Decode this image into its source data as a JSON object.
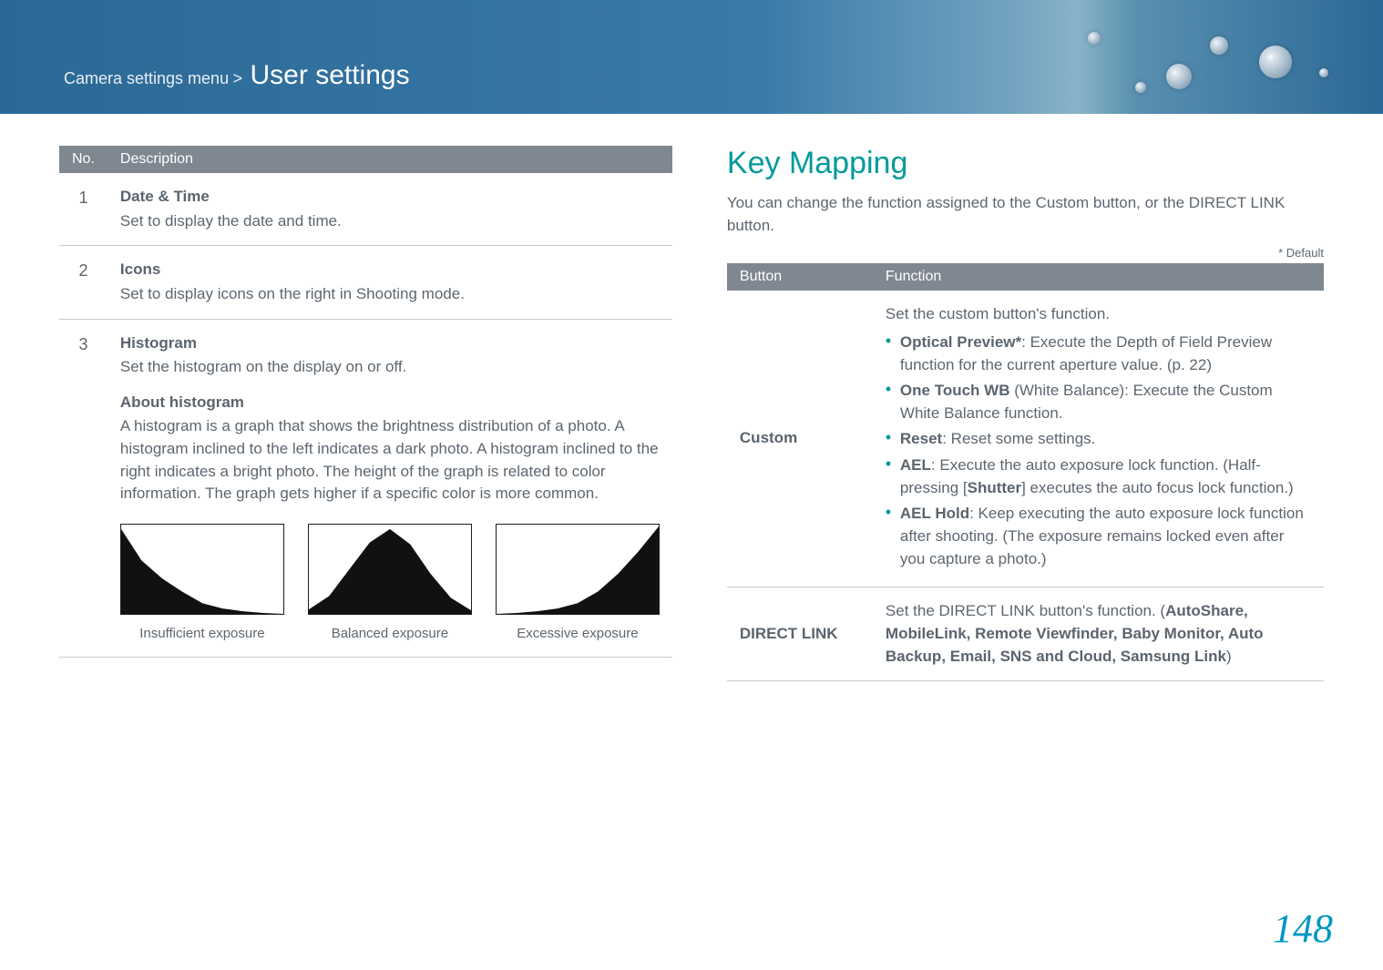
{
  "header": {
    "crumb": "Camera settings menu",
    "title": "User settings"
  },
  "left_table": {
    "headers": {
      "no": "No.",
      "desc": "Description"
    },
    "rows": [
      {
        "no": "1",
        "label": "Date & Time",
        "text": "Set to display the date and time."
      },
      {
        "no": "2",
        "label": "Icons",
        "text": "Set to display icons on the right in Shooting mode."
      }
    ],
    "row3": {
      "no": "3",
      "label": "Histogram",
      "intro": "Set the histogram on the display on or off.",
      "sub": "About histogram",
      "body": "A histogram is a graph that shows the brightness distribution of a photo. A histogram inclined to the left indicates a dark photo. A histogram inclined to the right indicates a bright photo. The height of the graph is related to color information. The graph gets higher if a specific color is more common.",
      "captions": {
        "a": "Insufficient exposure",
        "b": "Balanced exposure",
        "c": "Excessive exposure"
      }
    }
  },
  "right": {
    "section_title": "Key Mapping",
    "intro": "You can change the function assigned to the Custom button, or the DIRECT LINK button.",
    "default_note": "* Default",
    "headers": {
      "button": "Button",
      "func": "Function"
    },
    "custom": {
      "name": "Custom",
      "lead": "Set the custom button's function.",
      "items": [
        {
          "bold": "Optical Preview*",
          "text": ": Execute the Depth of Field Preview function for the current aperture value. (p. 22)"
        },
        {
          "bold": "One Touch WB",
          "paren": " (White Balance)",
          "text": ": Execute the Custom White Balance function."
        },
        {
          "bold": "Reset",
          "text": ": Reset some settings."
        },
        {
          "bold": "AEL",
          "text": ": Execute the auto exposure lock function. (Half-pressing [",
          "bold2": "Shutter",
          "text2": "] executes the auto focus lock function.)"
        },
        {
          "bold": "AEL Hold",
          "text": ": Keep executing the auto exposure lock function after shooting. (The exposure remains locked even after you capture a photo.)"
        }
      ]
    },
    "direct": {
      "name": "DIRECT LINK",
      "lead": "Set the DIRECT LINK button's function. (",
      "bold_opts": "AutoShare, MobileLink, Remote Viewfinder, Baby Monitor, Auto Backup, Email, SNS and Cloud, Samsung Link",
      "tail": ")"
    }
  },
  "chart_data": [
    {
      "type": "bar",
      "title": "Insufficient exposure",
      "xlabel": "",
      "ylabel": "",
      "ylim": [
        0,
        100
      ],
      "categories": [
        "0",
        "32",
        "64",
        "96",
        "128",
        "160",
        "192",
        "224",
        "255"
      ],
      "values": [
        95,
        60,
        40,
        25,
        12,
        6,
        3,
        1,
        0
      ]
    },
    {
      "type": "bar",
      "title": "Balanced exposure",
      "xlabel": "",
      "ylabel": "",
      "ylim": [
        0,
        100
      ],
      "categories": [
        "0",
        "32",
        "64",
        "96",
        "128",
        "160",
        "192",
        "224",
        "255"
      ],
      "values": [
        5,
        20,
        50,
        80,
        95,
        78,
        45,
        18,
        4
      ]
    },
    {
      "type": "bar",
      "title": "Excessive exposure",
      "xlabel": "",
      "ylabel": "",
      "ylim": [
        0,
        100
      ],
      "categories": [
        "0",
        "32",
        "64",
        "96",
        "128",
        "160",
        "192",
        "224",
        "255"
      ],
      "values": [
        0,
        1,
        3,
        6,
        12,
        25,
        45,
        70,
        98
      ]
    }
  ],
  "page_number": "148"
}
